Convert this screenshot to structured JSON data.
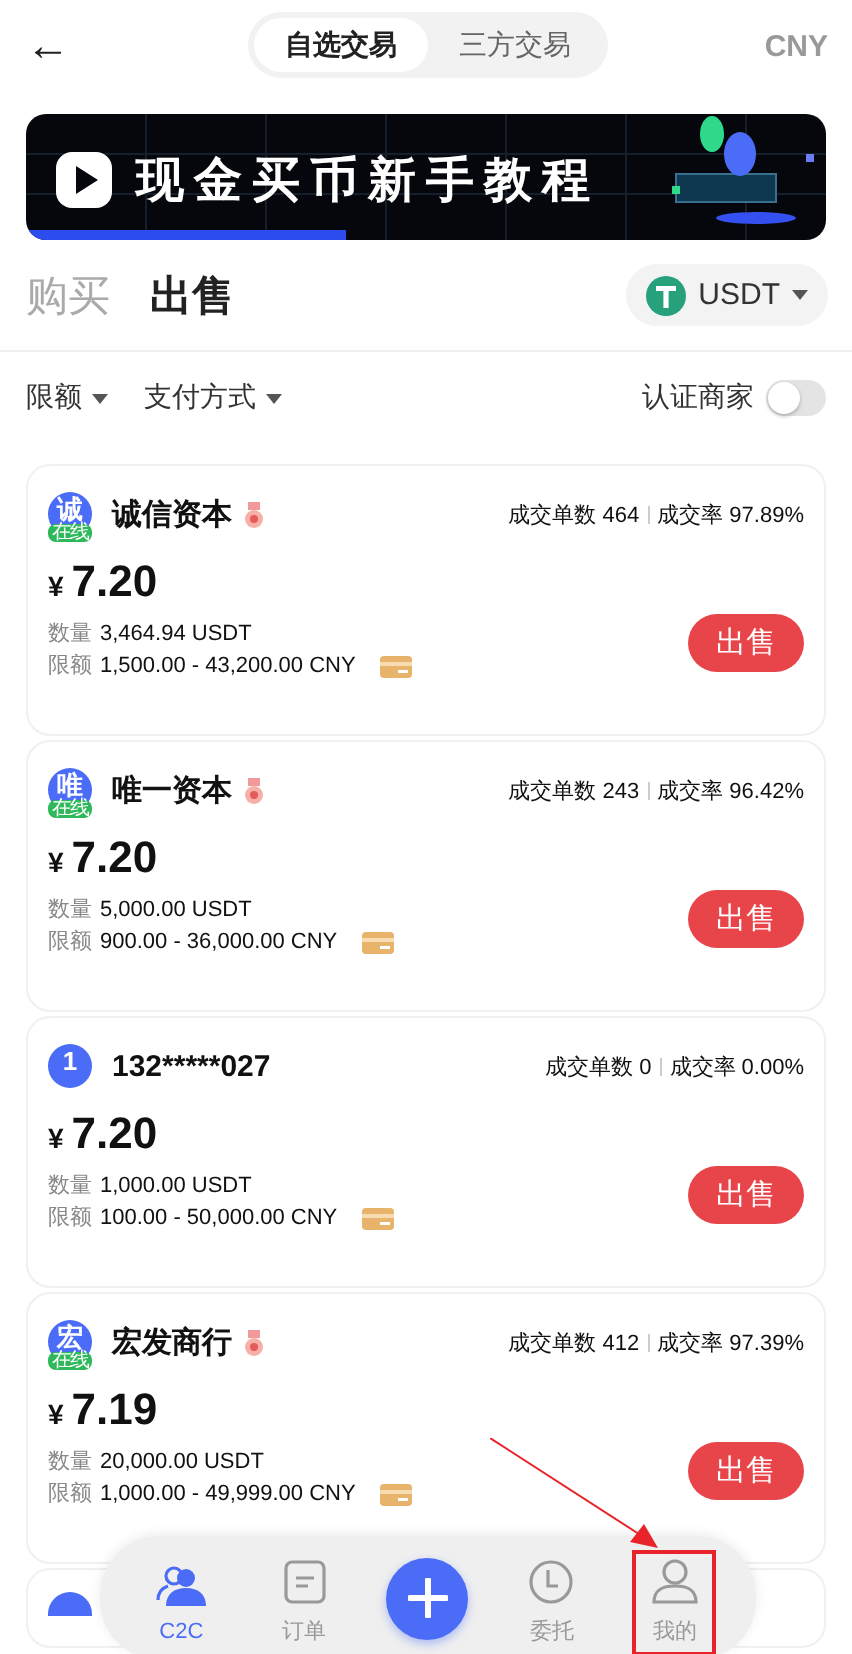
{
  "header": {
    "back": "←",
    "segments": [
      {
        "label": "自选交易",
        "selected": true
      },
      {
        "label": "三方交易",
        "selected": false
      }
    ],
    "currency": "CNY"
  },
  "banner": {
    "title": "现金买币新手教程"
  },
  "side_tabs": [
    {
      "label": "购买",
      "selected": false
    },
    {
      "label": "出售",
      "selected": true
    }
  ],
  "coin": {
    "label": "USDT"
  },
  "filters": [
    {
      "label": "限额"
    },
    {
      "label": "支付方式"
    }
  ],
  "verified_toggle": {
    "label": "认证商家",
    "on": false
  },
  "listings": [
    {
      "avatar": "诚",
      "online_badge": "在线",
      "medal": true,
      "name": "诚信资本",
      "orders_label": "成交单数",
      "orders": "464",
      "rate_label": "成交率",
      "rate": "97.89%",
      "currency_symbol": "¥",
      "price": "7.20",
      "qty_label": "数量",
      "qty": "3,464.94 USDT",
      "limit_label": "限额",
      "limit": "1,500.00 - 43,200.00 CNY",
      "action": "出售"
    },
    {
      "avatar": "唯",
      "online_badge": "在线",
      "medal": true,
      "name": "唯一资本",
      "orders_label": "成交单数",
      "orders": "243",
      "rate_label": "成交率",
      "rate": "96.42%",
      "currency_symbol": "¥",
      "price": "7.20",
      "qty_label": "数量",
      "qty": "5,000.00 USDT",
      "limit_label": "限额",
      "limit": "900.00 - 36,000.00 CNY",
      "action": "出售"
    },
    {
      "avatar": "1",
      "medal": false,
      "name": "132*****027",
      "orders_label": "成交单数",
      "orders": "0",
      "rate_label": "成交率",
      "rate": "0.00%",
      "currency_symbol": "¥",
      "price": "7.20",
      "qty_label": "数量",
      "qty": "1,000.00 USDT",
      "limit_label": "限额",
      "limit": "100.00 - 50,000.00 CNY",
      "action": "出售"
    },
    {
      "avatar": "宏",
      "online_badge": "在线",
      "medal": true,
      "name": "宏发商行",
      "orders_label": "成交单数",
      "orders": "412",
      "rate_label": "成交率",
      "rate": "97.39%",
      "currency_symbol": "¥",
      "price": "7.19",
      "qty_label": "数量",
      "qty": "20,000.00 USDT",
      "limit_label": "限额",
      "limit": "1,000.00 - 49,999.00 CNY",
      "action": "出售"
    }
  ],
  "nav": {
    "items": [
      {
        "label": "C2C",
        "kind": "users",
        "selected": true,
        "annotated": false
      },
      {
        "label": "订单",
        "kind": "doc",
        "selected": false,
        "annotated": false
      },
      {
        "label": "委托",
        "kind": "clock",
        "selected": false,
        "annotated": false
      },
      {
        "label": "我的",
        "kind": "person",
        "selected": false,
        "annotated": true
      }
    ]
  }
}
